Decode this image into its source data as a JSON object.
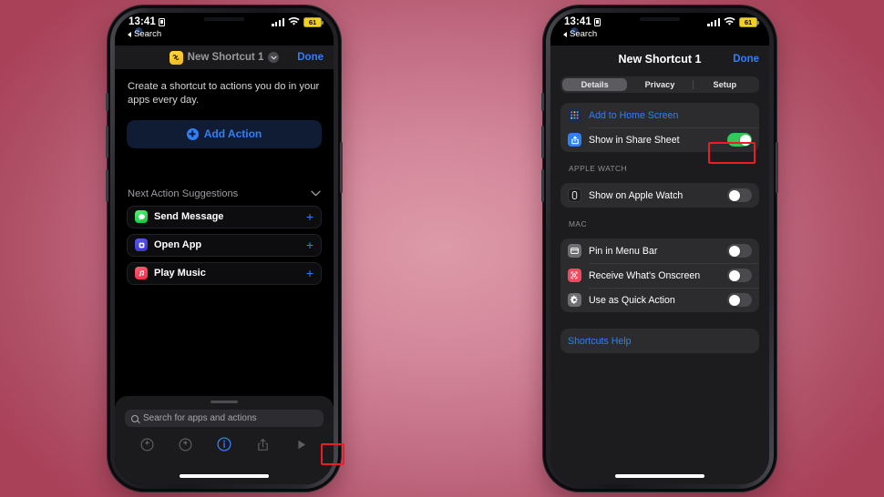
{
  "background": {
    "accent": "#c26d84",
    "highlight_color": "#ee1c24"
  },
  "status_bar": {
    "time": "13:41",
    "back_label": "Search",
    "battery_level": "61",
    "lock_icon": "lock-icon",
    "signal_icon": "cellular-signal-icon",
    "wifi_icon": "wifi-icon",
    "battery_icon": "battery-low-power-icon"
  },
  "left_phone": {
    "nav": {
      "shortcut_icon": "shortcut-glyph-icon",
      "title": "New Shortcut 1",
      "chevron_icon": "chevron-down-icon",
      "done_label": "Done"
    },
    "intro_text": "Create a shortcut to actions you do in your apps every day.",
    "add_action": {
      "label": "Add Action",
      "icon": "plus-circle-icon"
    },
    "suggestions": {
      "header": "Next Action Suggestions",
      "collapse_icon": "chevron-down-icon",
      "items": [
        {
          "label": "Send Message",
          "icon": "messages-app-icon",
          "add": "+"
        },
        {
          "label": "Open App",
          "icon": "open-app-icon",
          "add": "+"
        },
        {
          "label": "Play Music",
          "icon": "music-app-icon",
          "add": "+"
        }
      ]
    },
    "bottom_panel": {
      "grabber": "drag-handle",
      "search_placeholder": "Search for apps and actions",
      "search_icon": "search-icon",
      "toolbar": [
        {
          "name": "undo-icon",
          "highlighted": false
        },
        {
          "name": "redo-icon",
          "highlighted": false
        },
        {
          "name": "info-icon",
          "highlighted": true
        },
        {
          "name": "share-icon",
          "highlighted": false
        },
        {
          "name": "play-icon",
          "highlighted": false
        }
      ]
    }
  },
  "right_phone": {
    "nav": {
      "title": "New Shortcut 1",
      "done_label": "Done"
    },
    "tabs": [
      {
        "label": "Details",
        "active": true
      },
      {
        "label": "Privacy",
        "active": false
      },
      {
        "label": "Setup",
        "active": false
      }
    ],
    "main_group": [
      {
        "label": "Add to Home Screen",
        "icon": "home-screen-icon",
        "type": "link"
      },
      {
        "label": "Show in Share Sheet",
        "icon": "share-sheet-icon",
        "type": "toggle",
        "on": true,
        "highlighted": true
      }
    ],
    "sections": [
      {
        "header": "APPLE WATCH",
        "rows": [
          {
            "label": "Show on Apple Watch",
            "icon": "apple-watch-icon",
            "type": "toggle",
            "on": false
          }
        ]
      },
      {
        "header": "MAC",
        "rows": [
          {
            "label": "Pin in Menu Bar",
            "icon": "menu-bar-icon",
            "type": "toggle",
            "on": false
          },
          {
            "label": "Receive What's Onscreen",
            "icon": "onscreen-scan-icon",
            "type": "toggle",
            "on": false
          },
          {
            "label": "Use as Quick Action",
            "icon": "gear-icon",
            "type": "toggle",
            "on": false
          }
        ]
      }
    ],
    "help": {
      "label": "Shortcuts Help"
    }
  }
}
